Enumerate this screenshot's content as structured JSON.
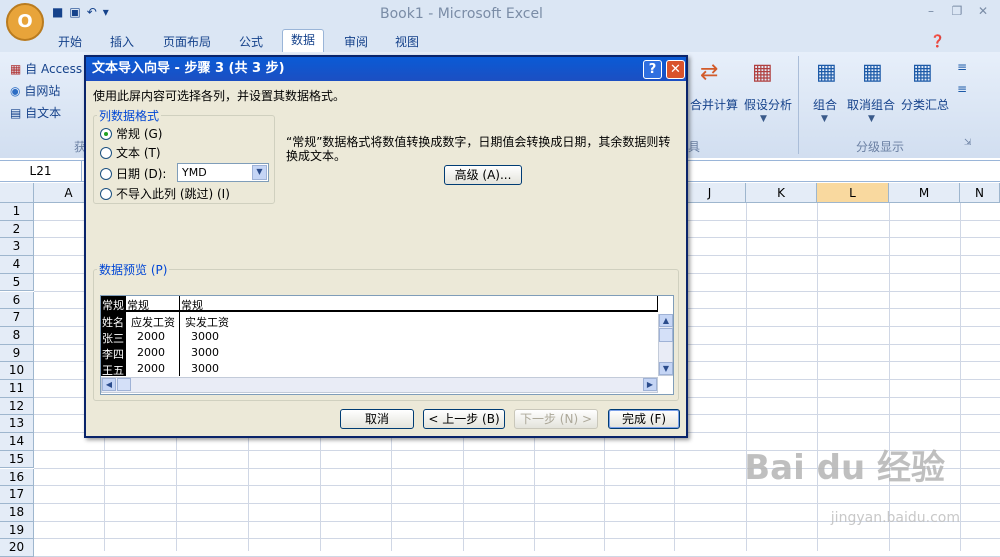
{
  "window": {
    "title": "Book1 - Microsoft Excel",
    "office_button": "O"
  },
  "tabs": [
    "开始",
    "插入",
    "页面布局",
    "公式",
    "数据",
    "审阅",
    "视图"
  ],
  "active_tab": 4,
  "ribbon": {
    "get_data": [
      "自 Access",
      "自网站",
      "自文本"
    ],
    "get_group_label": "获",
    "tools_group_label": "具",
    "consolidate": "合并计算",
    "whatif": "假设分析",
    "group": "组合",
    "ungroup": "取消组合",
    "subtotal": "分类汇总",
    "outline_label": "分级显示"
  },
  "namebox": "L21",
  "columns": [
    "A",
    "J",
    "K",
    "L",
    "M",
    "N"
  ],
  "selected_column": "L",
  "rows": [
    "1",
    "2",
    "3",
    "4",
    "5",
    "6",
    "7",
    "8",
    "9",
    "10",
    "11",
    "12",
    "13",
    "14",
    "15",
    "16",
    "17",
    "18",
    "19",
    "20"
  ],
  "dialog": {
    "title": "文本导入向导 - 步骤 3 (共 3 步)",
    "help": "?",
    "close": "✕",
    "instruction": "使用此屏内容可选择各列，并设置其数据格式。",
    "format_legend": "列数据格式",
    "radios": [
      "常规 (G)",
      "文本 (T)",
      "日期 (D):",
      "不导入此列 (跳过) (I)"
    ],
    "selected_radio": 0,
    "date_value": "YMD",
    "description": "“常规”数据格式将数值转换成数字，日期值会转换成日期，其余数据则转换成文本。",
    "advanced": "高级 (A)...",
    "preview_legend": "数据预览 (P)",
    "preview_headers": [
      "常规",
      "常规",
      "常规"
    ],
    "preview_rows": [
      [
        "姓名",
        "应发工资",
        "实发工资"
      ],
      [
        "张三",
        "2000",
        "3000"
      ],
      [
        "李四",
        "2000",
        "3000"
      ],
      [
        "王五",
        "2000",
        "3000"
      ]
    ],
    "buttons": {
      "cancel": "取消",
      "back": "< 上一步 (B)",
      "next": "下一步 (N) >",
      "finish": "完成 (F)"
    }
  },
  "watermark": {
    "brand": "Bai du 经验",
    "url": "jingyan.baidu.com"
  }
}
